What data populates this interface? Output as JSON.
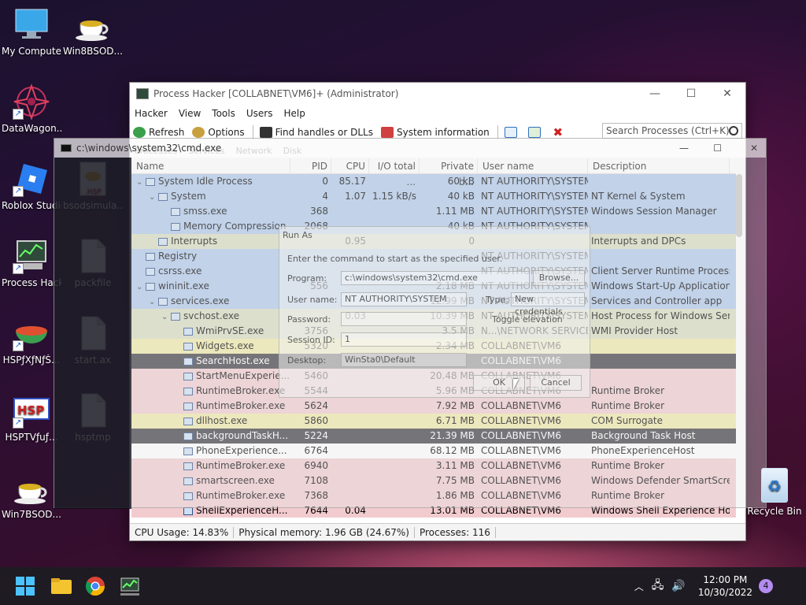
{
  "desktop": {
    "icons": [
      {
        "label": "My Computer",
        "icon": "monitor-icon"
      },
      {
        "label": "Win8BSOD....",
        "icon": "teacup-icon"
      },
      {
        "label": "DataWagon...",
        "icon": "mandala-icon"
      },
      {
        "label": "Roblox Studio",
        "icon": "roblox-icon"
      },
      {
        "label": "bsodsimula...",
        "icon": "hsp-file-icon"
      },
      {
        "label": "Process Hacker 2",
        "icon": "process-hacker-icon"
      },
      {
        "label": "packfile",
        "icon": "file-icon"
      },
      {
        "label": "HSPƒXƒNƒŠ...",
        "icon": "soup-bowl-icon"
      },
      {
        "label": "start.ax",
        "icon": "file-icon"
      },
      {
        "label": "HSPTVƒuƒ...",
        "icon": "hsp-logo-icon"
      },
      {
        "label": "hsptmp",
        "icon": "file-icon"
      },
      {
        "label": "Win7BSOD....",
        "icon": "teacup-icon"
      }
    ],
    "recycle_bin": "Recycle Bin"
  },
  "process_hacker": {
    "title": "Process Hacker [COLLABNET\\VM6]+ (Administrator)",
    "menu": [
      "Hacker",
      "View",
      "Tools",
      "Users",
      "Help"
    ],
    "toolbar": {
      "refresh": "Refresh",
      "options": "Options",
      "find_handles": "Find handles or DLLs",
      "system_info": "System information"
    },
    "search_placeholder": "Search Processes (Ctrl+K)",
    "tabs": [
      "Processes",
      "Services",
      "Network",
      "Disk"
    ],
    "columns": [
      "Name",
      "PID",
      "CPU",
      "I/O total ...",
      "Private b...",
      "User name",
      "Description"
    ],
    "rows": [
      {
        "indent": 0,
        "tw": "v",
        "name": "System Idle Process",
        "pid": "0",
        "cpu": "85.17",
        "io": "",
        "priv": "60 kB",
        "user": "NT AUTHORITY\\SYSTEM",
        "desc": "",
        "bg": "bg-sys"
      },
      {
        "indent": 1,
        "tw": "v",
        "name": "System",
        "pid": "4",
        "cpu": "1.07",
        "io": "1.15 kB/s",
        "priv": "40 kB",
        "user": "NT AUTHORITY\\SYSTEM",
        "desc": "NT Kernel & System",
        "bg": "bg-sys"
      },
      {
        "indent": 2,
        "tw": "",
        "name": "smss.exe",
        "pid": "368",
        "cpu": "",
        "io": "",
        "priv": "1.11 MB",
        "user": "NT AUTHORITY\\SYSTEM",
        "desc": "Windows Session Manager",
        "bg": "bg-sys"
      },
      {
        "indent": 2,
        "tw": "",
        "name": "Memory Compression",
        "pid": "2068",
        "cpu": "",
        "io": "",
        "priv": "40 kB",
        "user": "NT AUTHORITY\\SYSTEM",
        "desc": "",
        "bg": "bg-sys"
      },
      {
        "indent": 1,
        "tw": "",
        "name": "Interrupts",
        "pid": "",
        "cpu": "0.95",
        "io": "",
        "priv": "0",
        "user": "",
        "desc": "Interrupts and DPCs",
        "bg": "bg-svc"
      },
      {
        "indent": 0,
        "tw": "",
        "name": "Registry",
        "pid": "",
        "cpu": "",
        "io": "",
        "priv": "",
        "user": "NT AUTHORITY\\SYSTEM",
        "desc": "",
        "bg": "bg-sys"
      },
      {
        "indent": 0,
        "tw": "",
        "name": "csrss.exe",
        "pid": "",
        "cpu": "",
        "io": "",
        "priv": "",
        "user": "NT AUTHORITY\\SYSTEM",
        "desc": "Client Server Runtime Process",
        "bg": "bg-sys"
      },
      {
        "indent": 0,
        "tw": "v",
        "name": "wininit.exe",
        "pid": "556",
        "cpu": "",
        "io": "",
        "priv": "2.18 MB",
        "user": "NT AUTHORITY\\SYSTEM",
        "desc": "Windows Start-Up Application",
        "bg": "bg-sys"
      },
      {
        "indent": 1,
        "tw": "v",
        "name": "services.exe",
        "pid": "",
        "cpu": "",
        "io": "",
        "priv": "12.99 MB",
        "user": "NT AUTHORITY\\SYSTEM",
        "desc": "Services and Controller app",
        "bg": "bg-sys"
      },
      {
        "indent": 2,
        "tw": "v",
        "name": "svchost.exe",
        "pid": "",
        "cpu": "0.03",
        "io": "",
        "priv": "10.39 MB",
        "user": "NT AUTHORITY\\SYSTEM",
        "desc": "Host Process for Windows Ser...",
        "bg": "bg-svc"
      },
      {
        "indent": 3,
        "tw": "",
        "name": "WmiPrvSE.exe",
        "pid": "3756",
        "cpu": "",
        "io": "",
        "priv": "3.5 MB",
        "user": "N...\\NETWORK SERVICE",
        "desc": "WMI Provider Host",
        "bg": "bg-svc"
      },
      {
        "indent": 3,
        "tw": "",
        "name": "Widgets.exe",
        "pid": "5320",
        "cpu": "",
        "io": "",
        "priv": "2.34 MB",
        "user": "COLLABNET\\VM6",
        "desc": "",
        "bg": "bg-yellow"
      },
      {
        "indent": 3,
        "tw": "",
        "name": "SearchHost.exe",
        "pid": "",
        "cpu": "",
        "io": "",
        "priv": "",
        "user": "COLLABNET\\VM6",
        "desc": "",
        "bg": "bg-dark"
      },
      {
        "indent": 3,
        "tw": "",
        "name": "StartMenuExperie...",
        "pid": "5460",
        "cpu": "",
        "io": "",
        "priv": "20.48 MB",
        "user": "COLLABNET\\VM6",
        "desc": "",
        "bg": "bg-user"
      },
      {
        "indent": 3,
        "tw": "",
        "name": "RuntimeBroker.exe",
        "pid": "5544",
        "cpu": "",
        "io": "",
        "priv": "5.96 MB",
        "user": "COLLABNET\\VM6",
        "desc": "Runtime Broker",
        "bg": "bg-user"
      },
      {
        "indent": 3,
        "tw": "",
        "name": "RuntimeBroker.exe",
        "pid": "5624",
        "cpu": "",
        "io": "",
        "priv": "7.92 MB",
        "user": "COLLABNET\\VM6",
        "desc": "Runtime Broker",
        "bg": "bg-user"
      },
      {
        "indent": 3,
        "tw": "",
        "name": "dllhost.exe",
        "pid": "5860",
        "cpu": "",
        "io": "",
        "priv": "6.71 MB",
        "user": "COLLABNET\\VM6",
        "desc": "COM Surrogate",
        "bg": "bg-yellow"
      },
      {
        "indent": 3,
        "tw": "",
        "name": "backgroundTaskH...",
        "pid": "5224",
        "cpu": "",
        "io": "",
        "priv": "21.39 MB",
        "user": "COLLABNET\\VM6",
        "desc": "Background Task Host",
        "bg": "bg-dark"
      },
      {
        "indent": 3,
        "tw": "",
        "name": "PhoneExperience...",
        "pid": "6764",
        "cpu": "",
        "io": "",
        "priv": "68.12 MB",
        "user": "COLLABNET\\VM6",
        "desc": "PhoneExperienceHost",
        "bg": "bg-white"
      },
      {
        "indent": 3,
        "tw": "",
        "name": "RuntimeBroker.exe",
        "pid": "6940",
        "cpu": "",
        "io": "",
        "priv": "3.11 MB",
        "user": "COLLABNET\\VM6",
        "desc": "Runtime Broker",
        "bg": "bg-user"
      },
      {
        "indent": 3,
        "tw": "",
        "name": "smartscreen.exe",
        "pid": "7108",
        "cpu": "",
        "io": "",
        "priv": "7.75 MB",
        "user": "COLLABNET\\VM6",
        "desc": "Windows Defender SmartScre...",
        "bg": "bg-user"
      },
      {
        "indent": 3,
        "tw": "",
        "name": "RuntimeBroker.exe",
        "pid": "7368",
        "cpu": "",
        "io": "",
        "priv": "1.86 MB",
        "user": "COLLABNET\\VM6",
        "desc": "Runtime Broker",
        "bg": "bg-user"
      },
      {
        "indent": 3,
        "tw": "",
        "name": "ShellExperienceH...",
        "pid": "7644",
        "cpu": "0.04",
        "io": "",
        "priv": "13.01 MB",
        "user": "COLLABNET\\VM6",
        "desc": "Windows Shell Experience Host",
        "bg": "bg-user"
      }
    ],
    "status": {
      "cpu": "CPU Usage: 14.83%",
      "memory": "Physical memory: 1.96 GB (24.67%)",
      "processes": "Processes: 116"
    }
  },
  "cmd": {
    "title": "c:\\windows\\system32\\cmd.exe"
  },
  "run_as": {
    "title": "Run As",
    "instruction": "Enter the command to start as the specified user.",
    "program_label": "Program:",
    "program_value": "c:\\windows\\system32\\cmd.exe",
    "browse": "Browse...",
    "username_label": "User name:",
    "username_value": "NT AUTHORITY\\SYSTEM",
    "type_label": "Type:",
    "type_value": "New credentials",
    "password_label": "Password:",
    "toggle_label": "Toggle elevation",
    "session_label": "Session ID:",
    "session_value": "1",
    "desktop_label": "Desktop:",
    "desktop_value": "WinSta0\\Default",
    "ok": "OK",
    "cancel": "Cancel"
  },
  "taskbar": {
    "time": "12:00 PM",
    "date": "10/30/2022",
    "notifications": "4"
  }
}
